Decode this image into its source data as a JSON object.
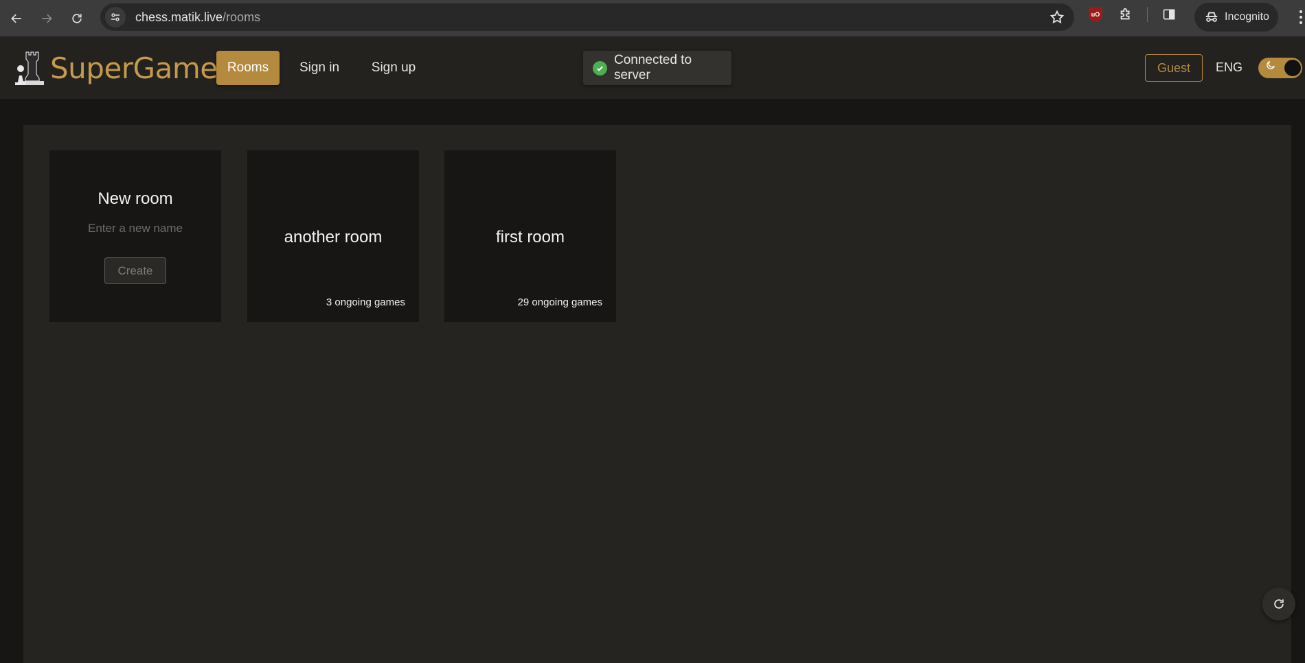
{
  "browser": {
    "url_host": "chess.matik.live",
    "url_path": "/rooms",
    "incognito_label": "Incognito",
    "ublock_badge": "uO"
  },
  "header": {
    "brand": "SuperGames",
    "nav": [
      {
        "label": "Rooms",
        "active": true
      },
      {
        "label": "Sign in",
        "active": false
      },
      {
        "label": "Sign up",
        "active": false
      }
    ],
    "status_toast": "Connected to server",
    "user_button": "Guest",
    "language": "ENG",
    "dark_mode": true
  },
  "rooms": {
    "new_room": {
      "title": "New room",
      "placeholder": "Enter a new name",
      "value": "",
      "create_label": "Create"
    },
    "list": [
      {
        "name": "another room",
        "games": "3 ongoing games"
      },
      {
        "name": "first room",
        "games": "29 ongoing games"
      }
    ]
  },
  "colors": {
    "accent": "#b48a3e",
    "brand_text": "#c49a4c",
    "success": "#4caf50",
    "page_bg": "#171614",
    "panel_bg": "#262421"
  },
  "icons": [
    "back-icon",
    "forward-icon",
    "reload-icon",
    "site-info-icon",
    "star-icon",
    "ublock-icon",
    "extensions-icon",
    "side-panel-icon",
    "incognito-icon",
    "menu-icon",
    "rook-logo-icon",
    "check-circle-icon",
    "moon-icon",
    "refresh-icon"
  ]
}
